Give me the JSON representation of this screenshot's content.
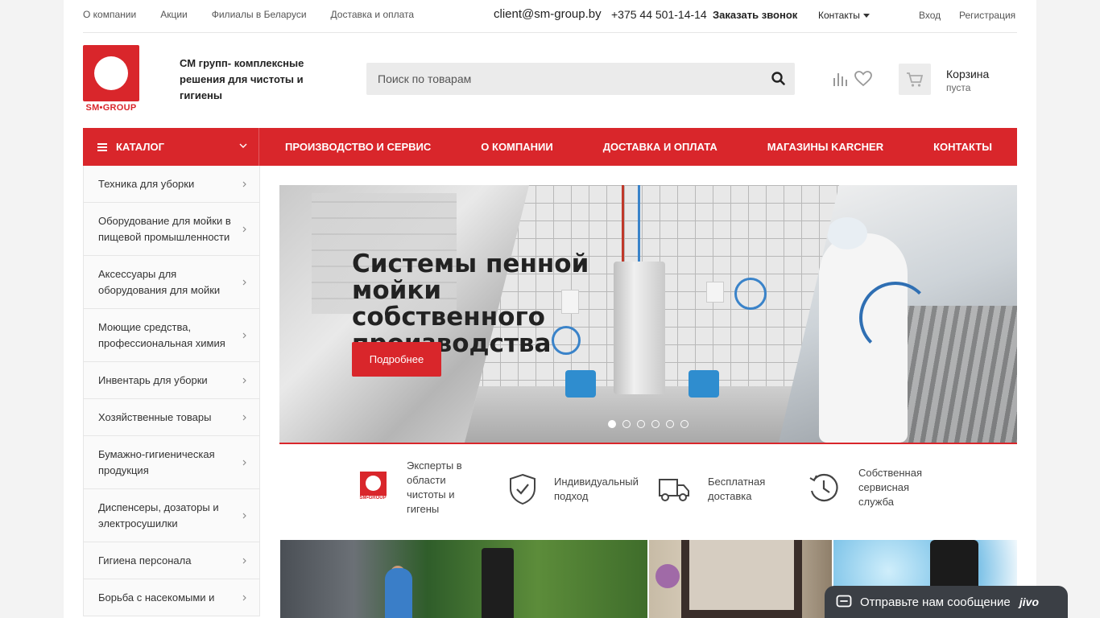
{
  "topbar": {
    "links": [
      "О компании",
      "Акции",
      "Филиалы в Беларуси",
      "Доставка и оплата"
    ],
    "email": "client@sm-group.by",
    "phone": "+375 44 501-14-14",
    "callback": "Заказать звонок",
    "contacts": "Контакты",
    "login": "Вход",
    "register": "Регистрация"
  },
  "header": {
    "logo_text": "SM•GROUP",
    "tagline": "СМ групп- комплексные решения для чистоты и гигиены",
    "search_placeholder": "Поиск по товарам",
    "cart_title": "Корзина",
    "cart_status": "пуста"
  },
  "nav": {
    "catalog": "КАТАЛОГ",
    "items": [
      "ПРОИЗВОДСТВО И СЕРВИС",
      "О КОМПАНИИ",
      "ДОСТАВКА И ОПЛАТА",
      "МАГАЗИНЫ KARCHER",
      "КОНТАКТЫ"
    ]
  },
  "sidebar": {
    "items": [
      "Техника для уборки",
      "Оборудование для мойки в пищевой промышленности",
      "Аксессуары для оборудования для мойки",
      "Моющие средства, профессиональная химия",
      "Инвентарь для уборки",
      "Хозяйственные товары",
      "Бумажно-гигиеническая продукция",
      "Диспенсеры, дозаторы и электросушилки",
      "Гигиена персонала",
      "Борьба с насекомыми и"
    ]
  },
  "banner": {
    "title": "Системы пенной мойки собственного производства",
    "button": "Подробнее",
    "slides_count": 6,
    "active_slide": 1
  },
  "features": [
    {
      "icon": "sm-group-logo-icon",
      "text": "Эксперты в области чистоты и гигены"
    },
    {
      "icon": "shield-check-icon",
      "text": "Индивидуальный подход"
    },
    {
      "icon": "truck-icon",
      "text": "Бесплатная доставка"
    },
    {
      "icon": "clock-history-icon",
      "text": "Собственная сервисная служба"
    }
  ],
  "chat": {
    "text": "Отправьте нам сообщение",
    "brand": "jivo"
  },
  "colors": {
    "accent": "#d9262b",
    "chat_bg": "#3b3f45"
  }
}
